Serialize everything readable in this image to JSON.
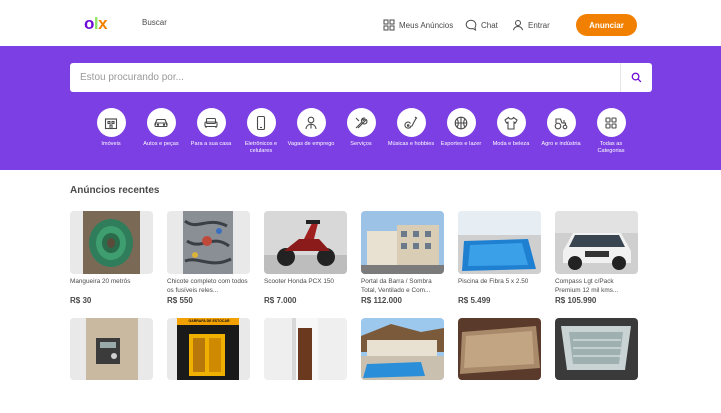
{
  "header": {
    "logo": {
      "o": "o",
      "l": "l",
      "x": "x"
    },
    "search_label": "Buscar",
    "my_ads_label": "Meus Anúncios",
    "chat_label": "Chat",
    "login_label": "Entrar",
    "announce_label": "Anunciar"
  },
  "hero": {
    "search_placeholder": "Estou procurando por...",
    "categories": [
      {
        "label": "Imóveis",
        "icon": "building-icon"
      },
      {
        "label": "Autos e peças",
        "icon": "car-icon"
      },
      {
        "label": "Para a sua casa",
        "icon": "sofa-icon"
      },
      {
        "label": "Eletrônicos e celulares",
        "icon": "phone-icon"
      },
      {
        "label": "Vagas de emprego",
        "icon": "person-icon"
      },
      {
        "label": "Serviços",
        "icon": "tools-icon"
      },
      {
        "label": "Músicas e hobbies",
        "icon": "guitar-icon"
      },
      {
        "label": "Esportes e lazer",
        "icon": "basketball-icon"
      },
      {
        "label": "Moda e beleza",
        "icon": "shirt-icon"
      },
      {
        "label": "Agro e indústria",
        "icon": "tractor-icon"
      },
      {
        "label": "Todas as Categorias",
        "icon": "grid-icon"
      }
    ]
  },
  "recent": {
    "title": "Anúncios recentes",
    "items": [
      {
        "title": "Mangueira 20 metrôs",
        "price": "R$ 30"
      },
      {
        "title": "Chicote completo com todos os fusíveis reles...",
        "price": "R$ 550"
      },
      {
        "title": "Scooter Honda PCX 150",
        "price": "R$ 7.000"
      },
      {
        "title": "Portal da Barra / Sombra Total, Ventilado e Com...",
        "price": "R$ 112.000"
      },
      {
        "title": "Piscina de Fibra 5 x 2.50",
        "price": "R$ 5.499"
      },
      {
        "title": "Compass Lgt c/Pack Premium 12 mil kms...",
        "price": "R$ 105.990"
      }
    ],
    "row2_banner_text": "GARRAFA DE ESTOCAR"
  },
  "colors": {
    "brand_purple": "#7c3fe4",
    "accent_orange": "#f28000",
    "text": "#4a4a4a"
  }
}
